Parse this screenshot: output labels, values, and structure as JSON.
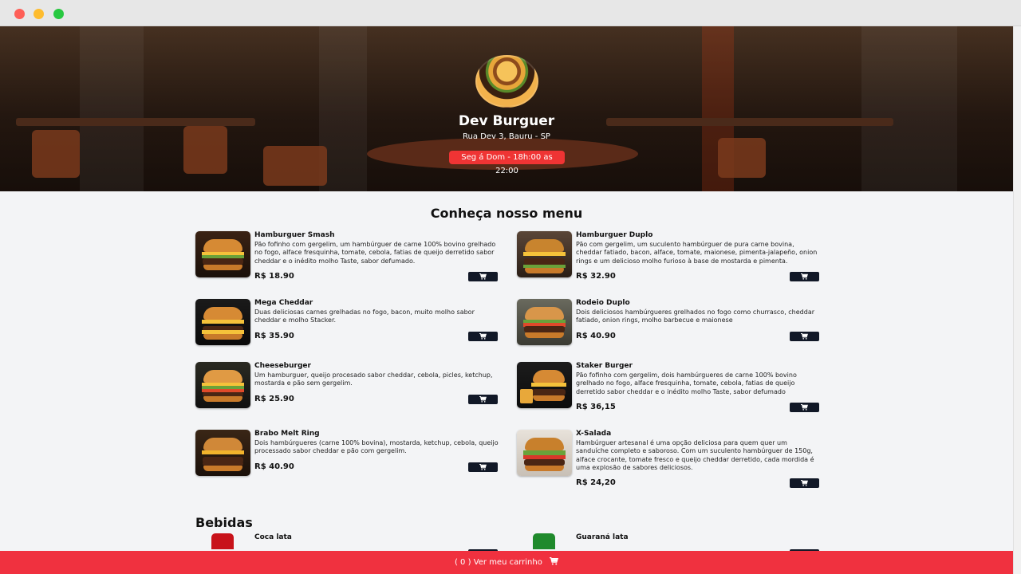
{
  "restaurant": {
    "name": "Dev Burguer",
    "address": "Rua Dev 3, Bauru - SP",
    "hours": "Seg á Dom - 18h:00 as 22:00"
  },
  "menu": {
    "title": "Conheça nosso menu",
    "burgers": [
      {
        "name": "Hamburguer Smash",
        "description": "Pão fofinho com gergelim, um hambúrguer de carne 100% bovino grelhado no fogo, alface fresquinha, tomate, cebola, fatias de queijo derretido sabor cheddar e o inédito molho Taste, sabor defumado.",
        "price": "R$ 18.90"
      },
      {
        "name": "Hamburguer Duplo",
        "description": "Pão com gergelim, um suculento hambúrguer de pura carne bovina, cheddar fatiado, bacon, alface, tomate, maionese, pimenta-jalapeño, onion rings e um delicioso molho furioso à base de mostarda e pimenta.",
        "price": "R$ 32.90"
      },
      {
        "name": "Mega Cheddar",
        "description": "Duas deliciosas carnes grelhadas no fogo, bacon, muito molho sabor cheddar e molho Stacker.",
        "price": "R$ 35.90"
      },
      {
        "name": "Rodeio Duplo",
        "description": "Dois deliciosos hambúrgueres grelhados no fogo como churrasco, cheddar fatiado, onion rings, molho barbecue e maionese",
        "price": "R$ 40.90"
      },
      {
        "name": "Cheeseburger",
        "description": "Um hamburguer, queijo procesado sabor cheddar, cebola, picles, ketchup, mostarda e pão sem gergelim.",
        "price": "R$ 25.90"
      },
      {
        "name": "Staker Burger",
        "description": "Pão fofinho com gergelim, dois hambúrgueres de carne 100% bovino grelhado no fogo, alface fresquinha, tomate, cebola, fatias de queijo derretido sabor cheddar e o inédito molho Taste, sabor defumado",
        "price": "R$ 36,15"
      },
      {
        "name": "Brabo Melt Ring",
        "description": "Dois hambúrgueres (carne 100% bovina), mostarda, ketchup, cebola, queijo processado sabor cheddar e pão com gergelim.",
        "price": "R$ 40.90"
      },
      {
        "name": "X-Salada",
        "description": "Hambúrguer artesanal é uma opção deliciosa para quem quer um sanduíche completo e saboroso. Com um suculento hambúrguer de 150g, alface crocante, tomate fresco e queijo cheddar derretido, cada mordida é uma explosão de sabores deliciosos.",
        "price": "R$ 24,20"
      }
    ]
  },
  "drinks": {
    "title": "Bebidas",
    "items": [
      {
        "name": "Coca lata"
      },
      {
        "name": "Guaraná lata"
      }
    ]
  },
  "cart": {
    "count": "0",
    "label": "Ver meu carrinho"
  },
  "icons": {
    "cart": "shopping-cart-icon"
  },
  "colors": {
    "accent": "#ef3434",
    "button": "#111827"
  }
}
